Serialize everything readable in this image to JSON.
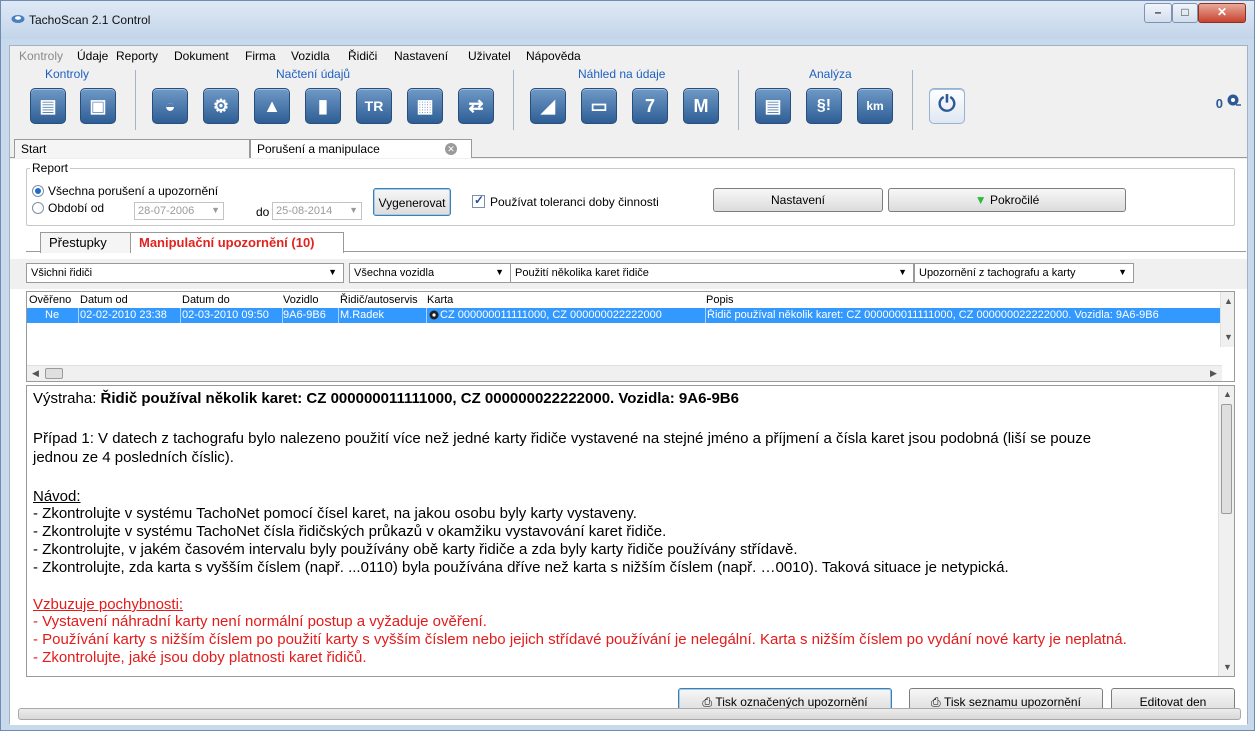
{
  "window": {
    "title": "TachoScan 2.1 Control",
    "minimize": "–",
    "maximize": "□",
    "close": "✕"
  },
  "menu": [
    "Kontroly",
    "Údaje",
    "Reporty",
    "Dokument",
    "Firma",
    "Vozidla",
    "Řidiči",
    "Nastavení",
    "Uživatel",
    "Nápověda"
  ],
  "ribbon": {
    "groups": [
      "Kontroly",
      "Načtení údajů",
      "Náhled na údaje",
      "Analýza"
    ],
    "buttons": {
      "k1": "▤",
      "k2": "▣",
      "n1": "◒",
      "n2": "⚙",
      "n3": "▲",
      "n4": "▮",
      "n5": "TR",
      "n6": "▦",
      "n7": "⇄",
      "h1": "◢",
      "h2": "▭",
      "h3": "7",
      "h4": "M",
      "a1": "▤",
      "a2": "§!",
      "a3": "km",
      "power": "⏻"
    },
    "right_counter": "0"
  },
  "doc_tabs": {
    "start": "Start",
    "active": "Porušení a manipulace"
  },
  "report": {
    "legend": "Report",
    "all_label": "Všechna porušení a upozornění",
    "period_label": "Období od",
    "date_from": "28-07-2006",
    "to_label": "do",
    "date_to": "25-08-2014",
    "generate": "Vygenerovat",
    "tolerance_label": "Používat toleranci doby činnosti",
    "settings": "Nastavení",
    "advanced": "Pokročilé"
  },
  "sub_tabs": {
    "violations": "Přestupky",
    "manipulation": "Manipulační upozornění (10)"
  },
  "filters": {
    "drivers": "Všichni řidiči",
    "vehicles": "Všechna vozidla",
    "type": "Použití několika karet řidiče",
    "source": "Upozornění z tachografu a karty"
  },
  "grid": {
    "headers": [
      "Ověřeno",
      "Datum od",
      "Datum do",
      "Vozidlo",
      "Řidič/autoservis",
      "Karta",
      "Popis"
    ],
    "row": {
      "verified": "Ne",
      "date_from": "02-02-2010 23:38",
      "date_to": "02-03-2010 09:50",
      "vehicle": "9A6-9B6",
      "driver": "M.Radek",
      "card": "CZ 000000011111000, CZ 000000022222000",
      "description": "Řidič používal několik karet: CZ 000000011111000, CZ 000000022222000. Vozidla: 9A6-9B6"
    }
  },
  "detail": {
    "warning_prefix": "Výstraha: ",
    "warning_bold": "Řidič používal několik karet: CZ 000000011111000, CZ 000000022222000. Vozidla: 9A6-9B6",
    "case1_line1": "Případ 1: V datech z tachografu bylo nalezeno použití více než jedné karty řidiče vystavené na stejné jméno a příjmení a čísla karet jsou podobná (liší se pouze",
    "case1_line2": "jednou ze 4 posledních číslic).",
    "guide_title": "Návod:",
    "guide": [
      "- Zkontrolujte v systému TachoNet pomocí čísel karet, na jakou osobu byly karty vystaveny.",
      "- Zkontrolujte v systému TachoNet čísla řidičských průkazů v okamžiku vystavování karet řidiče.",
      "- Zkontrolujte, v jakém časovém intervalu byly používány obě karty řidiče a zda byly karty řidiče používány střídavě.",
      "- Zkontrolujte, zda karta s vyšším číslem (např. ...0110) byla používána dříve než karta s nižším číslem (např. …0010). Taková situace je netypická."
    ],
    "doubt_title": "Vzbuzuje pochybnosti:",
    "doubt": [
      "- Vystavení náhradní karty není normální postup a vyžaduje ověření.",
      "- Používání karty s nižším číslem po použití karty s vyšším číslem nebo jejich střídavé používání je nelegální. Karta s nižším číslem po vydání nové karty je neplatná.",
      "- Zkontrolujte, jaké jsou doby platnosti karet řidičů."
    ]
  },
  "bottom": {
    "print_marked": "Tisk označených upozornění",
    "print_list": "Tisk seznamu upozornění",
    "edit_day": "Editovat den"
  },
  "colors": {
    "selection": "#3399ff",
    "accent_red": "#e31b1b",
    "ribbon_label": "#1f5fbf"
  }
}
